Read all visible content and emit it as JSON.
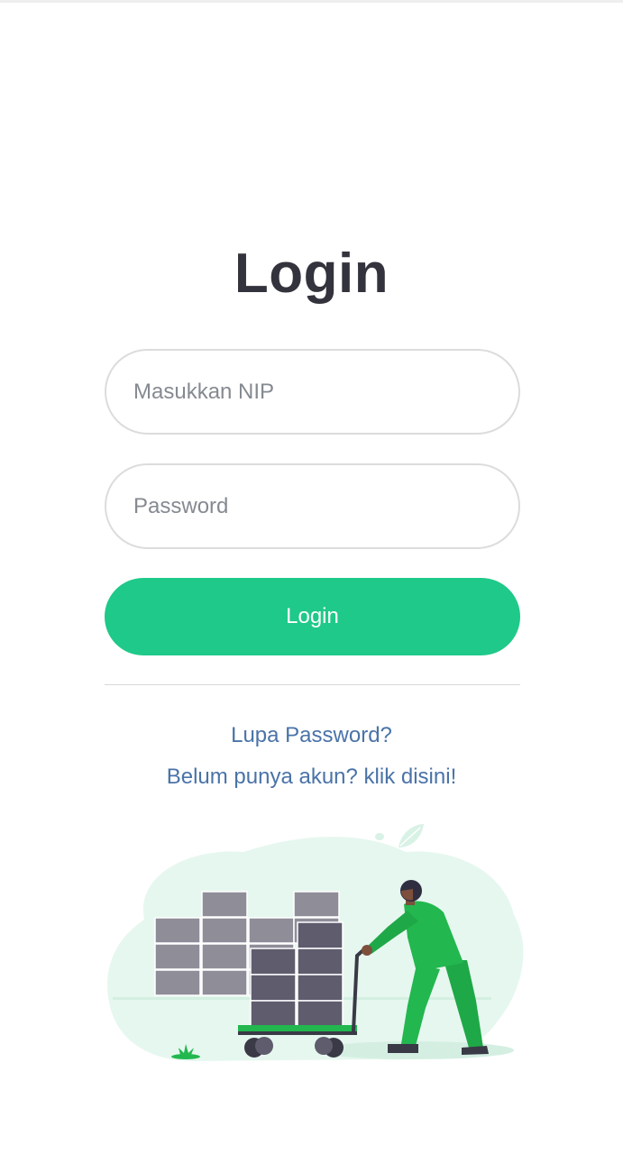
{
  "login": {
    "title": "Login",
    "nip_placeholder": "Masukkan NIP",
    "password_placeholder": "Password",
    "submit_label": "Login",
    "forgot_link": "Lupa Password?",
    "register_link": "Belum punya akun? klik disini!"
  },
  "colors": {
    "accent": "#1fc989",
    "title": "#33333d",
    "link": "#4a73a8",
    "illustration_figure": "#22b74f",
    "illustration_boxes": "#5f5c6e"
  },
  "illustration": {
    "name": "worker-pushing-cart-of-boxes"
  }
}
